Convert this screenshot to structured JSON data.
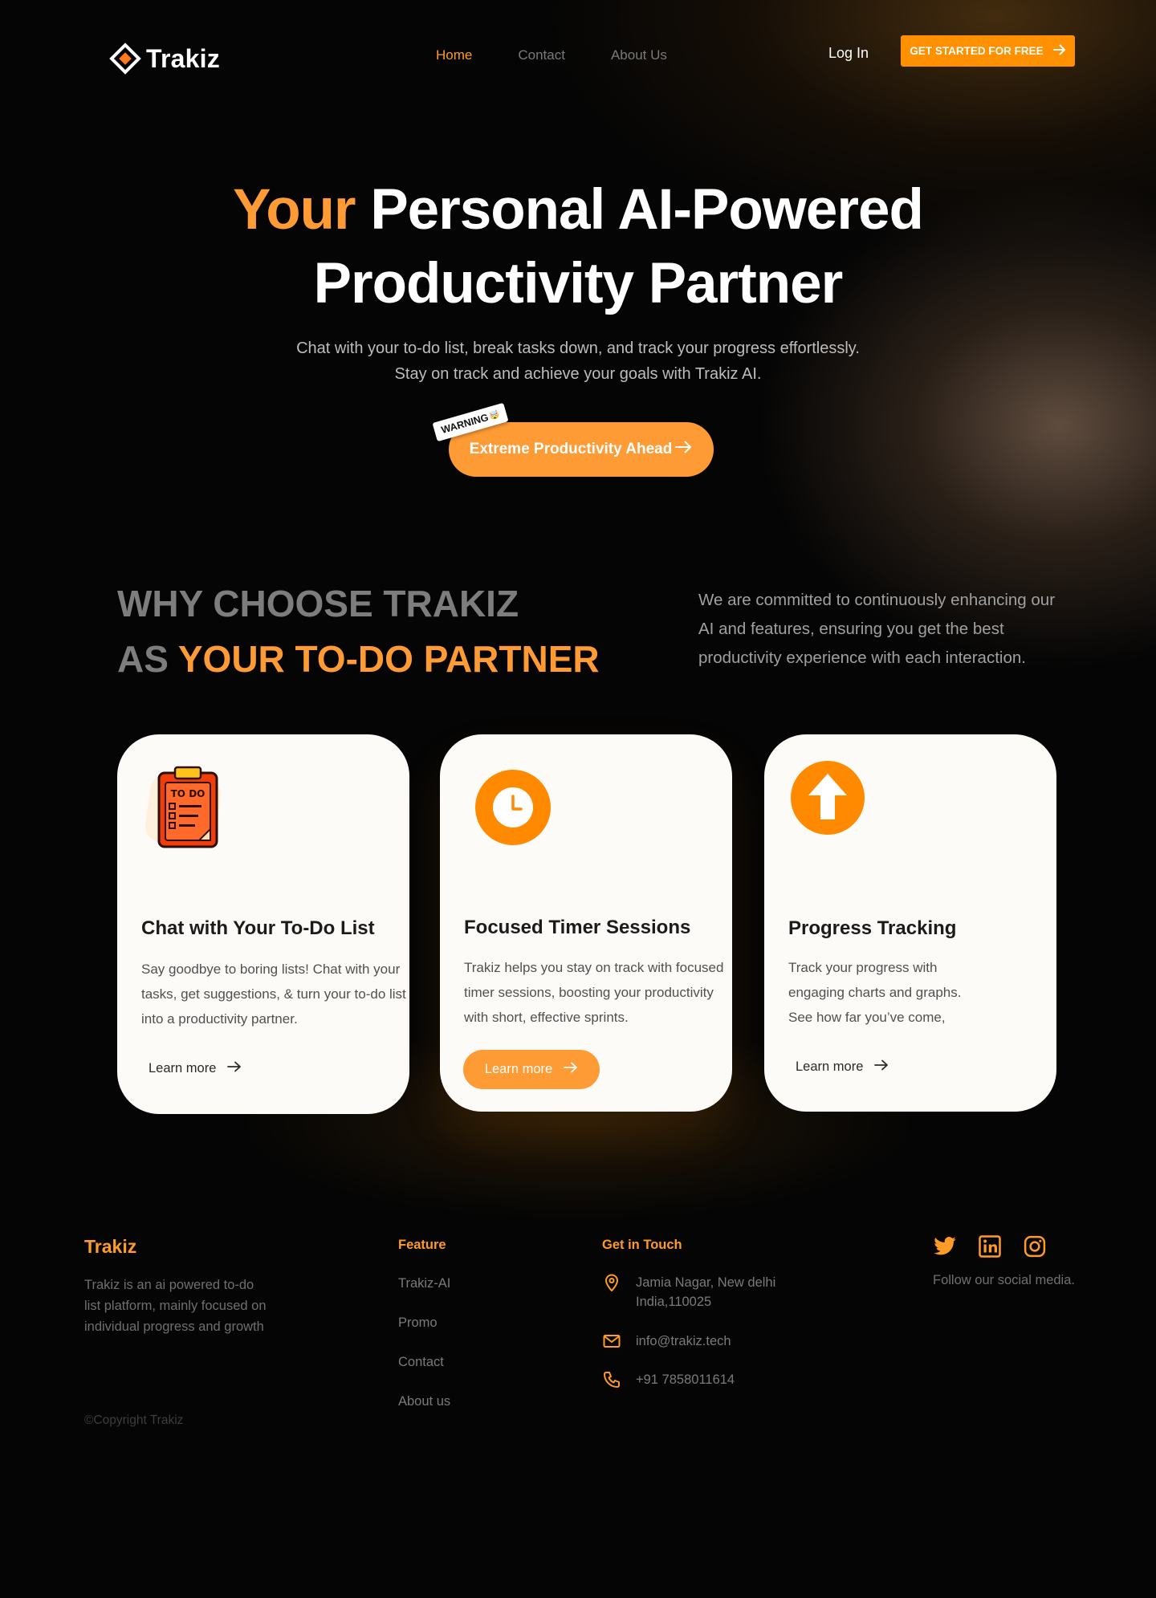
{
  "brand": {
    "name": "Trakiz",
    "logo_icon": "diamond-logo-icon"
  },
  "nav": {
    "links": [
      {
        "label": "Home",
        "active": true
      },
      {
        "label": "Contact",
        "active": false
      },
      {
        "label": "About Us",
        "active": false
      }
    ],
    "login": "Log In",
    "cta": "GET STARTED FOR FREE"
  },
  "hero": {
    "title_accent": "Your",
    "title_line1_rest": "Personal AI-Powered",
    "title_line2": "Productivity Partner",
    "subtitle_line1": "Chat with your to-do list, break tasks down, and track your progress effortlessly.",
    "subtitle_line2": "Stay on track and achieve your goals with Trakiz AI.",
    "button_label": "Extreme Productivity Ahead",
    "warning_tag": "WARNING",
    "warning_emoji": "🤯"
  },
  "why": {
    "title_line1": "WHY CHOOSE TRAKIZ",
    "title_line2_prefix": "AS",
    "title_line2_accent": "YOUR TO-DO PARTNER",
    "description": "We are committed to continuously enhancing our AI and features, ensuring you get the best productivity experience with each interaction."
  },
  "cards": [
    {
      "icon": "todo-clipboard-icon",
      "icon_label": "TO DO",
      "title": "Chat with Your To-Do List",
      "body": "Say goodbye to boring lists! Chat with your tasks, get suggestions, & turn your to-do list into a productivity partner.",
      "link": "Learn more"
    },
    {
      "icon": "clock-icon",
      "title": "Focused Timer Sessions",
      "body": "Trakiz helps you stay on track with focused timer sessions, boosting your productivity with short, effective sprints.",
      "link": "Learn more"
    },
    {
      "icon": "arrow-up-circle-icon",
      "title": "Progress Tracking",
      "body": "Track your progress with engaging charts and graphs. See how far you’ve come,",
      "link": "Learn more"
    }
  ],
  "footer": {
    "brand": "Trakiz",
    "description": "Trakiz is an ai powered to-do list platform, mainly focused on individual progress and growth",
    "copyright": "©Copyright Trakiz",
    "feature_heading": "Feature",
    "feature_links": [
      "Trakiz-AI",
      "Promo",
      "Contact",
      "About us"
    ],
    "contact_heading": "Get in Touch",
    "address_line1": "Jamia Nagar, New delhi",
    "address_line2": "India,110025",
    "email": "info@trakiz.tech",
    "phone": "+91 7858011614",
    "social": [
      "twitter-icon",
      "linkedin-icon",
      "instagram-icon"
    ],
    "follow_text": "Follow our social media."
  },
  "colors": {
    "accent": "#ff9b35",
    "cta": "#ff9100",
    "card_bg": "#fdfbf8",
    "background": "#050505"
  }
}
